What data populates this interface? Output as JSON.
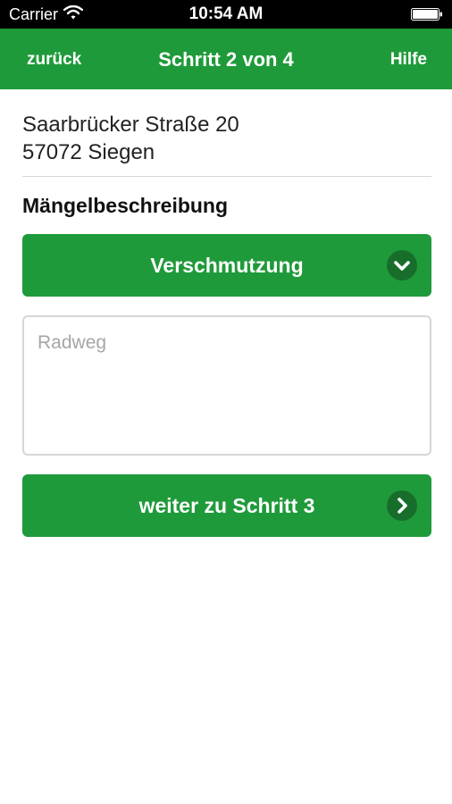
{
  "status_bar": {
    "carrier": "Carrier",
    "time": "10:54 AM",
    "wifi_icon": "wifi-icon",
    "battery_icon": "battery-icon"
  },
  "nav": {
    "back_label": "zurück",
    "title": "Schritt 2 von 4",
    "help_label": "Hilfe"
  },
  "address": {
    "street": "Saarbrücker Straße 20",
    "city": "57072 Siegen"
  },
  "defect": {
    "section_title": "Mängelbeschreibung",
    "category_selected": "Verschmutzung",
    "category_icon": "chevron-down-circle-icon",
    "description_placeholder": "Radweg",
    "description_value": ""
  },
  "next": {
    "label": "weiter zu Schritt 3",
    "icon": "chevron-right-circle-icon"
  },
  "colors": {
    "brand_green": "#1f9a3a",
    "icon_circle": "#176e2b"
  }
}
